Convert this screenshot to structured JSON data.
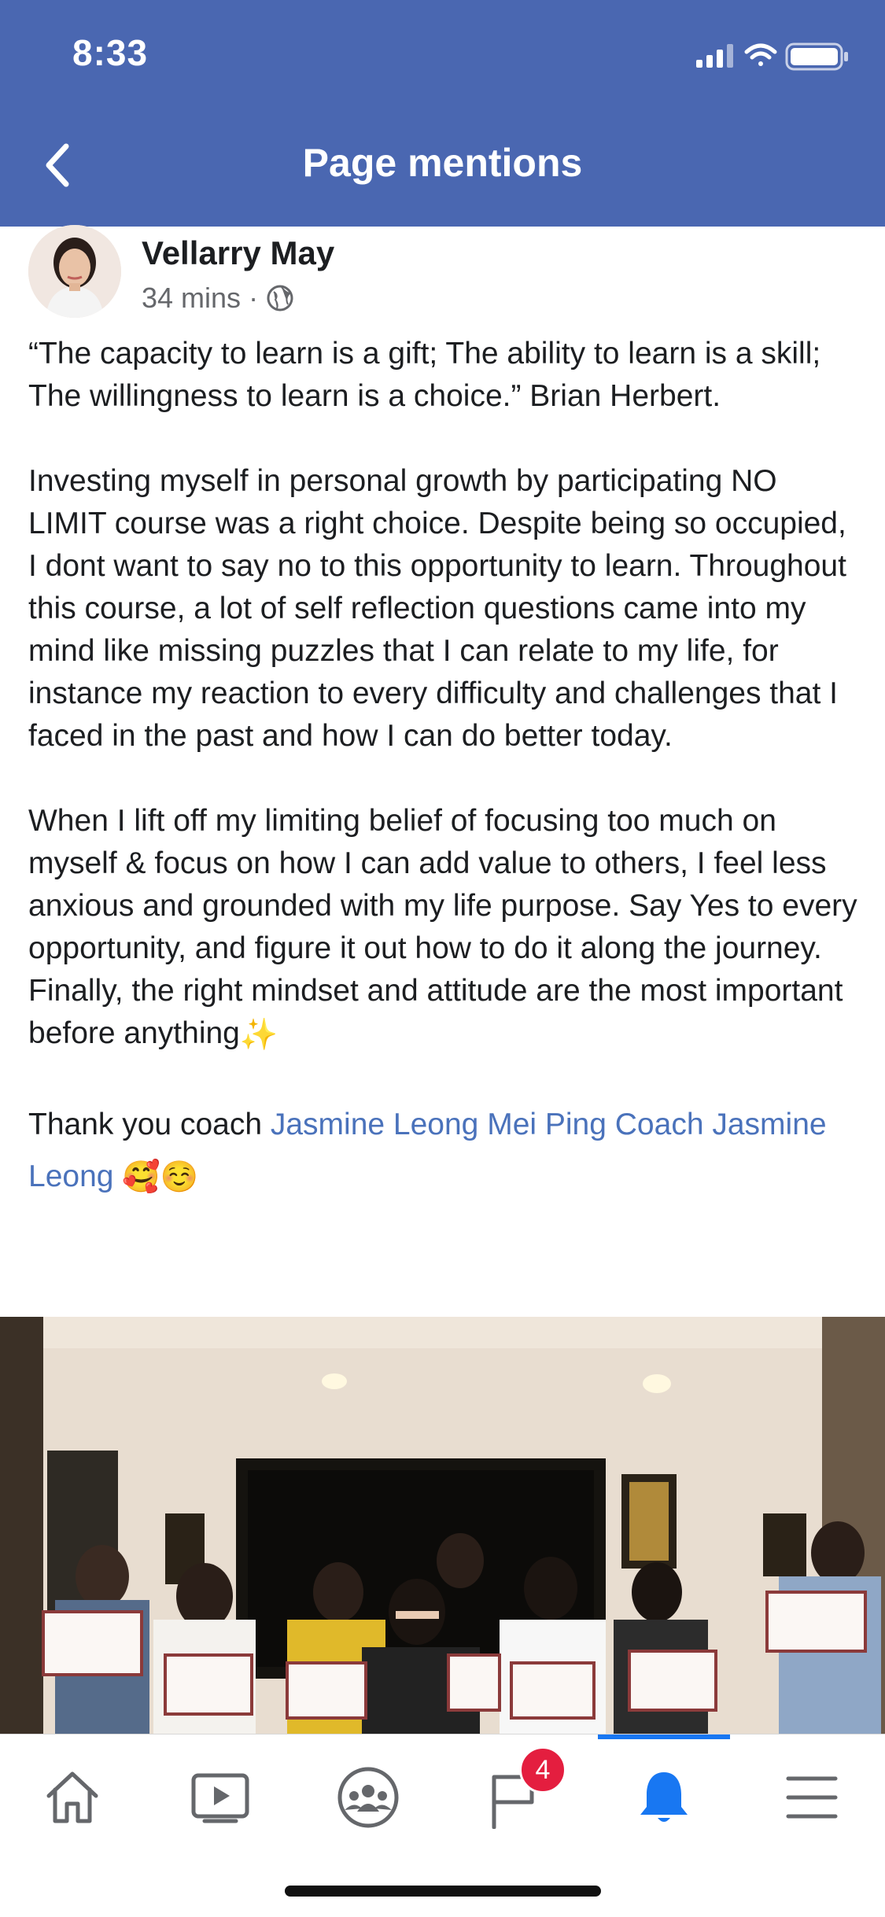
{
  "status_bar": {
    "time": "8:33"
  },
  "header": {
    "title": "Page mentions",
    "back_icon": "chevron-left-icon"
  },
  "post": {
    "author": "Vellarry May",
    "time": "34 mins",
    "separator": "·",
    "privacy_icon": "globe-icon",
    "paragraphs": [
      "“The capacity to learn is a gift; The ability to learn is a skill; The willingness to learn is a choice.”  Brian Herbert.",
      "Investing myself in personal growth by participating NO LIMIT course was a right choice. Despite being so occupied, I dont want to say no to this opportunity to learn. Throughout this course, a lot of self reflection questions came into my mind like missing puzzles that I can relate to my life, for instance my reaction to every difficulty and challenges that I faced in the past and how I can do better today.",
      "When I lift off my limiting belief of focusing too much on myself & focus on how I can add value to others, I feel less anxious and grounded with my life purpose. Say Yes to every opportunity, and figure it out how to do it along the journey. Finally, the right mindset and attitude are the most important before anything"
    ],
    "paragraph3_emoji": "✨",
    "thanks_prefix": "Thank you coach ",
    "mention_1": "Jasmine Leong Mei Ping Coach",
    "mention_2": "Jasmine Leong",
    "thanks_emojis": "🥰☺️"
  },
  "tabbar": {
    "items": [
      "home-icon",
      "video-icon",
      "groups-icon",
      "pages-flag-icon",
      "notifications-bell-icon",
      "menu-icon"
    ],
    "active": "notifications-bell-icon",
    "badge_count": "4"
  },
  "colors": {
    "header_bg": "#4a67b1",
    "link": "#4a72bb",
    "active_tab": "#1877f2",
    "badge": "#e41e3f"
  }
}
